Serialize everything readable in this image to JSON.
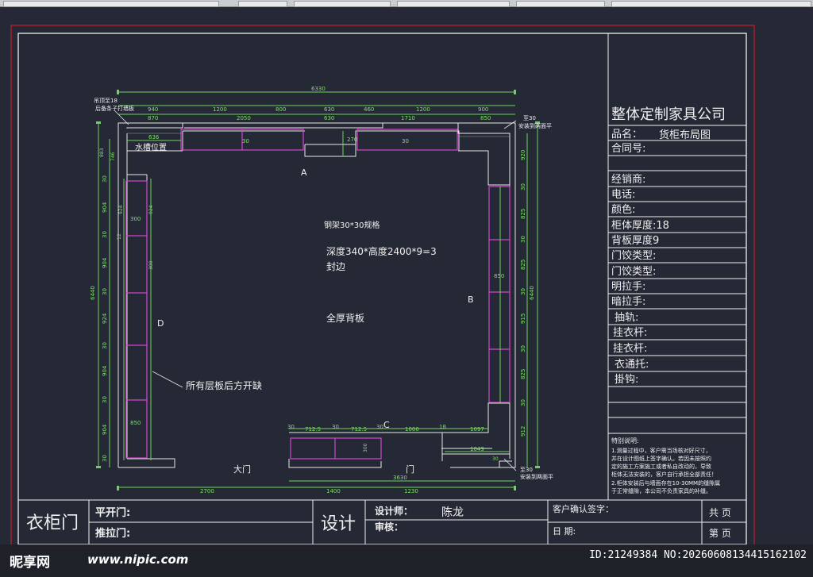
{
  "title_block": {
    "company": "整体定制家具公司",
    "product_label": "品名：",
    "product_value": "货柜布局图",
    "fields": [
      "合同号:",
      "",
      "经销商:",
      "电话:",
      "颜色:",
      "柜体厚度:18",
      "背板厚度9",
      "门饺类型:",
      "门饺类型:",
      "明拉手:",
      "暗拉手:",
      "抽轨:",
      "挂衣杆:",
      "挂衣杆:",
      "衣通托:",
      "掛钩:"
    ],
    "notes_title": "特别说明:",
    "notes": [
      "1.测量过程中，客户需当场核对好尺寸，",
      "并在设计图纸上签字确认。若因未按照约",
      "定的施工方案施工或者私自改动的，导致",
      "柜体无法安装的，客户自行承担全部责任！",
      "2.柜体安装后与墙面存在10-30MM的缝隙属",
      "于正常缝隙，本公司不负责家具的补缝。"
    ]
  },
  "bottom_block": {
    "main_label": "衣柜门",
    "hinge_door": "平开门:",
    "sliding_door": "推拉门:",
    "design_label": "设计",
    "designer_label": "设计师：",
    "designer_name": "陈龙",
    "review_label": "审核：",
    "customer_sign": "客户确认签字：",
    "date_label": "日    期:",
    "total_pages": "共    页",
    "page_no": "第    页"
  },
  "plan": {
    "label_a": "A",
    "label_b": "B",
    "label_c": "C",
    "label_d": "D",
    "steel": "钢架30*30规格",
    "spec": "深度340*高度2400*9=3",
    "edge": "封边",
    "backboard": "全厚背板",
    "shelf_note": "所有层板后方开缺",
    "main_door": "大门",
    "door": "门",
    "water_tank": "水槽位置",
    "hang_top": "吊顶至18",
    "top_note": "后备条子打墙板",
    "install_top": "安装到两面平",
    "install_bottom": "安装到两面平",
    "to30_top": "至30",
    "to30_bottom": "至30"
  },
  "dims": {
    "top_total": "6330",
    "top_row1": [
      "940",
      "1200",
      "800",
      "630",
      "460",
      "1200",
      "900"
    ],
    "top_row2": [
      "870",
      "2050",
      "630",
      "1710",
      "850"
    ],
    "top_small": [
      "636",
      "270",
      "30",
      "30"
    ],
    "left_outer": "6440",
    "left_ticks": [
      "30",
      "904",
      "30",
      "904",
      "30",
      "924",
      "30",
      "904",
      "30",
      "904",
      "30"
    ],
    "left_inner": [
      "300",
      "924",
      "300",
      "924"
    ],
    "left_small": [
      "12",
      "746",
      "883",
      "850"
    ],
    "right_outer": "6440",
    "right_ticks": [
      "920",
      "30",
      "825",
      "30",
      "825",
      "30",
      "915",
      "30",
      "825",
      "30",
      "912"
    ],
    "right_inner": "850",
    "bottom_inner": [
      "30",
      "712.5",
      "30",
      "712.5",
      "30",
      "1000",
      "18",
      "1097"
    ],
    "bottom_small": [
      "1049",
      "300",
      "30"
    ],
    "bottom_total": "3630",
    "bottom_row": [
      "2700",
      "1400",
      "1230"
    ]
  },
  "watermark": {
    "logo": "昵享网",
    "url": "www.nipic.com",
    "id": "ID:21249384 NO:20260608134415162102"
  },
  "colors": {
    "background": "#252835",
    "wall": "#e8e8e8",
    "cabinet": "#d046d0",
    "dimension": "#6fd35a",
    "frame": "#c21f2a"
  }
}
